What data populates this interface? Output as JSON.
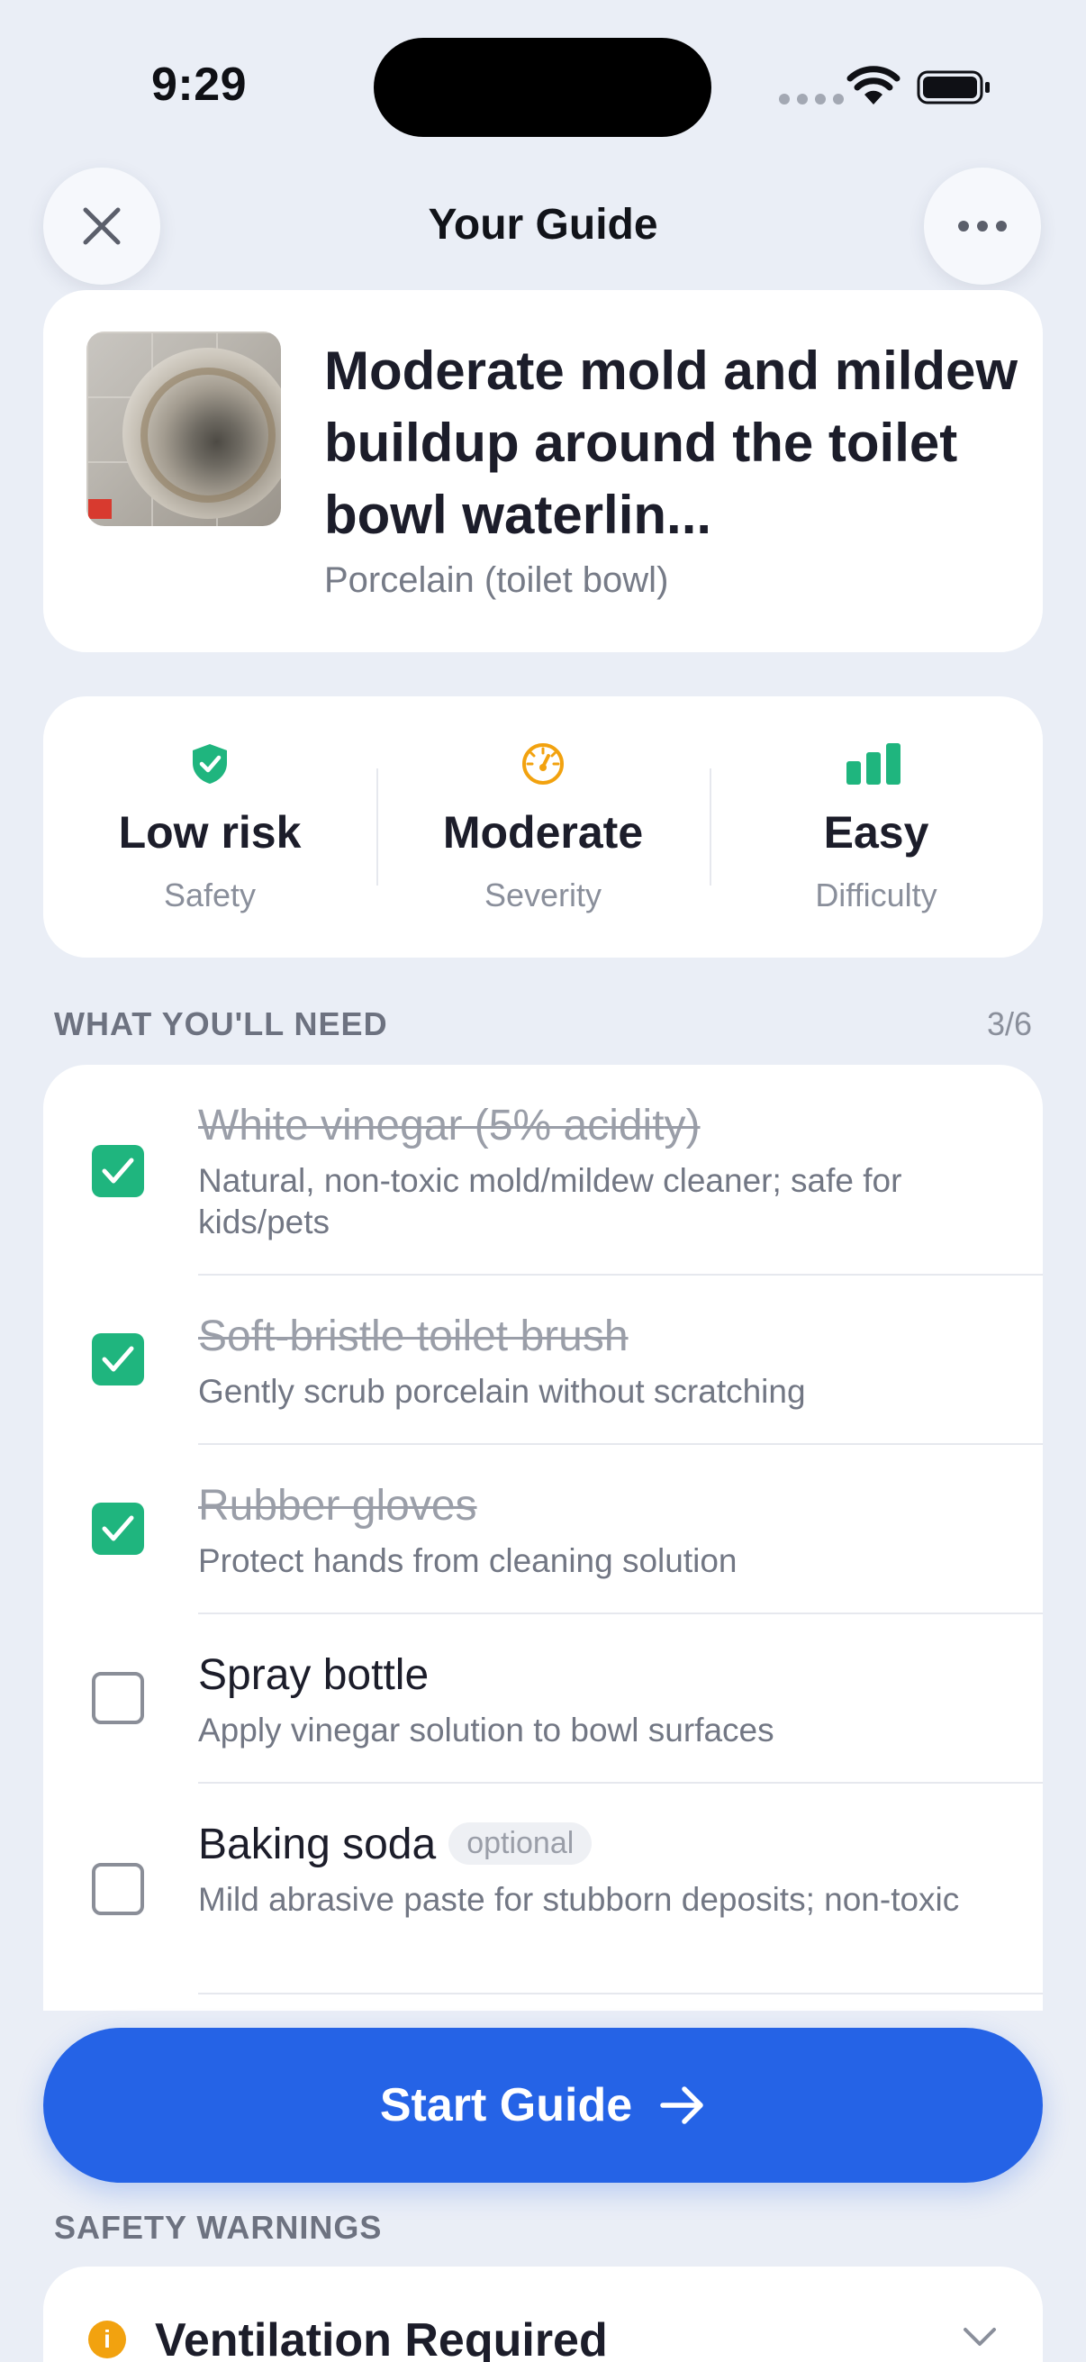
{
  "status_bar": {
    "time": "9:29"
  },
  "nav": {
    "title": "Your Guide",
    "close_icon": "close-icon",
    "more_icon": "ellipsis-icon"
  },
  "issue": {
    "title": "Moderate mold and mildew buildup around the toilet bowl waterlin...",
    "material": "Porcelain (toilet bowl)"
  },
  "stats": [
    {
      "value": "Low risk",
      "label": "Safety",
      "icon": "shield-check-icon",
      "color": "#1fb57e"
    },
    {
      "value": "Moderate",
      "label": "Severity",
      "icon": "gauge-icon",
      "color": "#f2a20f"
    },
    {
      "value": "Easy",
      "label": "Difficulty",
      "icon": "bars-icon",
      "color": "#1fb57e"
    }
  ],
  "needs": {
    "header": "WHAT YOU'LL NEED",
    "count": "3/6",
    "items": [
      {
        "name": "White vinegar (5% acidity)",
        "desc": "Natural, non-toxic mold/mildew cleaner; safe for kids/pets",
        "checked": true
      },
      {
        "name": "Soft-bristle toilet brush",
        "desc": "Gently scrub porcelain without scratching",
        "checked": true
      },
      {
        "name": "Rubber gloves",
        "desc": "Protect hands from cleaning solution",
        "checked": true
      },
      {
        "name": "Spray bottle",
        "desc": "Apply vinegar solution to bowl surfaces",
        "checked": false
      },
      {
        "name": "Baking soda",
        "tag": "optional",
        "desc": "Mild abrasive paste for stubborn deposits; non-toxic",
        "checked": false
      }
    ]
  },
  "start_button": {
    "label": "Start Guide"
  },
  "safety": {
    "header": "SAFETY WARNINGS",
    "first_warning": "Ventilation Required"
  },
  "colors": {
    "accent": "#2563e6",
    "success": "#1fb57e",
    "warning": "#f2a20f"
  }
}
